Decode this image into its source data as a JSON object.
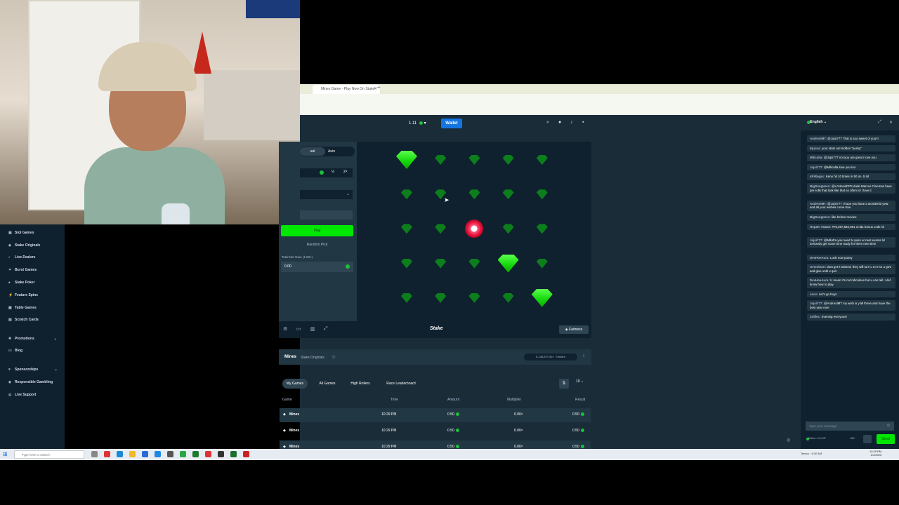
{
  "browser": {
    "tab_title": "Mines Game - Play Now On Stake",
    "new_tab": "+"
  },
  "header": {
    "balance": "1.11",
    "wallet_label": "Wallet"
  },
  "sidebar": {
    "items": [
      {
        "label": "Slot Games",
        "icon": "slots-icon"
      },
      {
        "label": "Stake Originals",
        "icon": "originals-icon"
      },
      {
        "label": "Live Dealers",
        "icon": "live-icon"
      },
      {
        "label": "Burst Games",
        "icon": "burst-icon"
      },
      {
        "label": "Stake Poker",
        "icon": "poker-icon"
      },
      {
        "label": "Feature Spins",
        "icon": "spins-icon"
      },
      {
        "label": "Table Games",
        "icon": "table-icon"
      },
      {
        "label": "Scratch Cards",
        "icon": "scratch-icon"
      },
      {
        "label": "Promotions",
        "icon": "promo-icon"
      },
      {
        "label": "Blog",
        "icon": "blog-icon"
      },
      {
        "label": "Sponsorships",
        "icon": "sponsor-icon"
      },
      {
        "label": "Responsible Gambling",
        "icon": "shield-icon"
      },
      {
        "label": "Live Support",
        "icon": "headset-icon"
      }
    ]
  },
  "controls": {
    "mode_manual": "ual",
    "mode_auto": "Auto",
    "half": "½",
    "double": "2×",
    "play": "Play",
    "random_pick": "Random Pick",
    "profit_label": "Total Net Gain (1.00×)",
    "profit_value": "0.00"
  },
  "board": {
    "tiles": [
      "gem-big",
      "gem",
      "gem",
      "gem",
      "gem",
      "gem",
      "gem",
      "gem",
      "gem",
      "gem",
      "gem",
      "gem",
      "bomb",
      "gem",
      "gem",
      "gem",
      "gem",
      "gem",
      "gem-big",
      "gem",
      "gem",
      "gem",
      "gem",
      "gem",
      "gem-big"
    ]
  },
  "footer": {
    "logo": "Stake",
    "fairness": "Fairness"
  },
  "game_info": {
    "name": "Mines",
    "category": "Stake Originals",
    "badge": "5,148,297.00× · Hidden"
  },
  "bets": {
    "tabs": [
      "My Games",
      "All Games",
      "High Rollers",
      "Race Leaderboard"
    ],
    "count": "10",
    "columns": [
      "Game",
      "Time",
      "Amount",
      "Multiplier",
      "Result"
    ],
    "rows": [
      {
        "game": "Mines",
        "time": "10:29 PM",
        "amount": "0.50",
        "multiplier": "0.00×",
        "result": "0.50"
      },
      {
        "game": "Mines",
        "time": "10:29 PM",
        "amount": "0.50",
        "multiplier": "0.00×",
        "result": "0.50"
      },
      {
        "game": "Mines",
        "time": "10:29 PM",
        "amount": "0.50",
        "multiplier": "0.00×",
        "result": "0.50"
      }
    ]
  },
  "chat": {
    "language": "English",
    "messages": [
      {
        "user": "AndreolMT:",
        "text": "@Jojsi777 That is soo sweet of you!!!"
      },
      {
        "user": "Epicus:",
        "text": "your stats are hidden \"pussy\""
      },
      {
        "user": "Milicalta:",
        "text": "@Jojsi777 not you are great i love you"
      },
      {
        "user": "Jojsi777:",
        "text": "@Milicalta love you too"
      },
      {
        "user": "IdriRagac:",
        "text": "Keno hit 10 times in 50 on .5 lol"
      },
      {
        "user": "BigDongHero:",
        "text": "@LANnoolFPS dude Marcus Cinemas have pre-rolls that look like that so often lol I love it"
      },
      {
        "user": "AndreolMT:",
        "text": "@Jojsi777 I hope you have a wonderful year and all your wishes come true"
      },
      {
        "user": "BigDongHero:",
        "text": "like before movies"
      },
      {
        "user": "Hop2It:",
        "text": "House: #76,357,682,061 on $1 bonus code lol"
      },
      {
        "user": "Jojsi777:",
        "text": "@MiloRa you need to pass ur next exams lol seriously get some time study for them next time"
      },
      {
        "user": "DevHoeAura:",
        "text": "Look now pussy"
      },
      {
        "user": "terombom:",
        "text": "dont get it twisted, they will turn u to 0 so u give and give until u quit"
      },
      {
        "user": "DevHoeAura:",
        "text": "U mean it's not ridiculous but u can tell. I def know how to play"
      },
      {
        "user": "cncv:",
        "text": "Let's go boys"
      },
      {
        "user": "Jojsi777:",
        "text": "@AndreolMT my wish is y'all thrive and have the best year ever"
      },
      {
        "user": "Zolilec:",
        "text": "Evening everyone!"
      }
    ],
    "input_placeholder": "Type your message",
    "online": "Online: 13,247",
    "char_count": "160",
    "send": "Send"
  },
  "taskbar": {
    "search_placeholder": "Type here to search",
    "tray_text": "Tempo · 6:30 AM",
    "time": "10:29 PM",
    "date": "1/1/2023"
  }
}
